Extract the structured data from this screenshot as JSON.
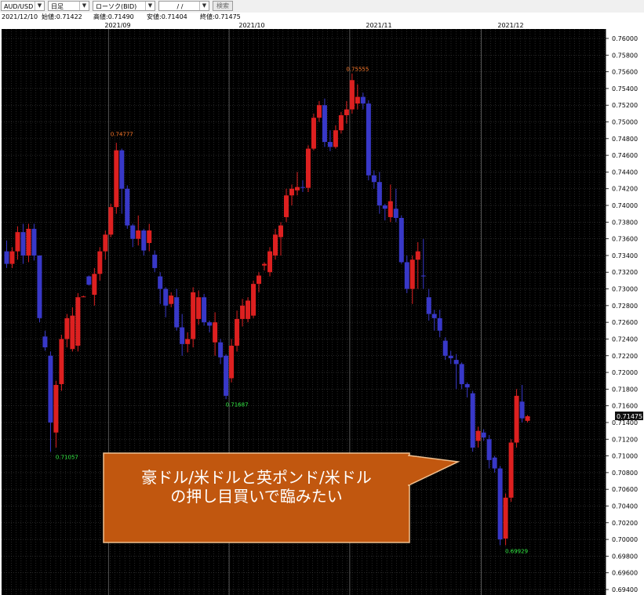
{
  "toolbar": {
    "symbol": "AUD/USD",
    "period": "日足",
    "chart_type": "ローソク(BID)",
    "date": "/ /",
    "search_label": "検索"
  },
  "info": {
    "date": "2021/12/10",
    "open": "始値:0.71422",
    "high": "高値:0.71490",
    "low": "安値:0.71404",
    "close": "終値:0.71475"
  },
  "callout": {
    "line1": "豪ドル/米ドルと英ポンド/米ドル",
    "line2": "の押し目買いで臨みたい"
  },
  "colors": {
    "up": "#dd2020",
    "down": "#3838c8",
    "background": "#000000",
    "grid": "#4a4a4a",
    "callout_fill": "#c1570f"
  },
  "chart_data": {
    "type": "candlestick",
    "x_labels": [
      "2021/09",
      "2021/10",
      "2021/11",
      "2021/12"
    ],
    "y_ticks": [
      "0.76000",
      "0.75800",
      "0.75600",
      "0.75400",
      "0.75200",
      "0.75000",
      "0.74800",
      "0.74600",
      "0.74400",
      "0.74200",
      "0.74000",
      "0.73800",
      "0.73600",
      "0.73400",
      "0.73200",
      "0.73000",
      "0.72800",
      "0.72600",
      "0.72400",
      "0.72200",
      "0.72000",
      "0.71800",
      "0.71600",
      "0.71400",
      "0.71200",
      "0.71000",
      "0.70800",
      "0.70600",
      "0.70400",
      "0.70200",
      "0.70000",
      "0.69800",
      "0.69600",
      "0.69400"
    ],
    "ylim": [
      0.694,
      0.762
    ],
    "current_price": "0.71475",
    "annotations": [
      {
        "text": "0.71057",
        "price": 0.71057,
        "kind": "low"
      },
      {
        "text": "0.74777",
        "price": 0.74777,
        "kind": "high"
      },
      {
        "text": "0.71687",
        "price": 0.71687,
        "kind": "low"
      },
      {
        "text": "0.75555",
        "price": 0.75555,
        "kind": "high"
      },
      {
        "text": "0.69929",
        "price": 0.69929,
        "kind": "low"
      }
    ],
    "candles": [
      [
        0.7345,
        0.7358,
        0.7325,
        0.733
      ],
      [
        0.733,
        0.735,
        0.7325,
        0.7345
      ],
      [
        0.7345,
        0.7375,
        0.7335,
        0.7368
      ],
      [
        0.7368,
        0.7378,
        0.733,
        0.734
      ],
      [
        0.734,
        0.7378,
        0.7332,
        0.7372
      ],
      [
        0.7372,
        0.7378,
        0.7334,
        0.734
      ],
      [
        0.734,
        0.734,
        0.726,
        0.7265
      ],
      [
        0.7243,
        0.725,
        0.7226,
        0.723
      ],
      [
        0.722,
        0.7225,
        0.7105,
        0.714
      ],
      [
        0.7128,
        0.719,
        0.711,
        0.7185
      ],
      [
        0.7186,
        0.7245,
        0.7178,
        0.724
      ],
      [
        0.724,
        0.727,
        0.723,
        0.7265
      ],
      [
        0.7228,
        0.7278,
        0.7225,
        0.7268
      ],
      [
        0.7232,
        0.7295,
        0.7225,
        0.729
      ],
      [
        0.729,
        0.7292,
        0.729,
        0.7291
      ],
      [
        0.7315,
        0.7316,
        0.7304,
        0.7305
      ],
      [
        0.7293,
        0.7325,
        0.728,
        0.7318
      ],
      [
        0.7318,
        0.735,
        0.731,
        0.7345
      ],
      [
        0.7345,
        0.737,
        0.7335,
        0.7365
      ],
      [
        0.7365,
        0.7402,
        0.7362,
        0.7398
      ],
      [
        0.7398,
        0.7475,
        0.739,
        0.7466
      ],
      [
        0.7466,
        0.7468,
        0.739,
        0.742
      ],
      [
        0.742,
        0.7424,
        0.7372,
        0.7376
      ],
      [
        0.7376,
        0.7378,
        0.735,
        0.736
      ],
      [
        0.736,
        0.7388,
        0.7352,
        0.737
      ],
      [
        0.737,
        0.7372,
        0.734,
        0.7346
      ],
      [
        0.7355,
        0.7378,
        0.7345,
        0.737
      ],
      [
        0.7341,
        0.7346,
        0.732,
        0.7325
      ],
      [
        0.7315,
        0.732,
        0.7282,
        0.73
      ],
      [
        0.73,
        0.7302,
        0.7266,
        0.728
      ],
      [
        0.7282,
        0.7296,
        0.7278,
        0.7292
      ],
      [
        0.729,
        0.73,
        0.725,
        0.7254
      ],
      [
        0.7254,
        0.727,
        0.722,
        0.7234
      ],
      [
        0.7234,
        0.7248,
        0.7224,
        0.724
      ],
      [
        0.724,
        0.7302,
        0.723,
        0.7296
      ],
      [
        0.7264,
        0.7298,
        0.7257,
        0.729
      ],
      [
        0.729,
        0.7294,
        0.7256,
        0.726
      ],
      [
        0.726,
        0.7262,
        0.7248,
        0.7256
      ],
      [
        0.7236,
        0.7272,
        0.722,
        0.726
      ],
      [
        0.7236,
        0.724,
        0.721,
        0.7218
      ],
      [
        0.722,
        0.7222,
        0.7168,
        0.7172
      ],
      [
        0.7193,
        0.724,
        0.7188,
        0.7232
      ],
      [
        0.7232,
        0.7274,
        0.7225,
        0.7264
      ],
      [
        0.7264,
        0.7288,
        0.7255,
        0.728
      ],
      [
        0.7264,
        0.729,
        0.726,
        0.7286
      ],
      [
        0.7268,
        0.731,
        0.7265,
        0.7306
      ],
      [
        0.7306,
        0.732,
        0.7296,
        0.7316
      ],
      [
        0.7328,
        0.7332,
        0.7322,
        0.733
      ],
      [
        0.732,
        0.735,
        0.7315,
        0.7345
      ],
      [
        0.734,
        0.7372,
        0.7335,
        0.7365
      ],
      [
        0.7362,
        0.738,
        0.734,
        0.7376
      ],
      [
        0.7386,
        0.742,
        0.738,
        0.7412
      ],
      [
        0.7412,
        0.7425,
        0.74,
        0.742
      ],
      [
        0.7418,
        0.744,
        0.7412,
        0.7422
      ],
      [
        0.7422,
        0.743,
        0.7416,
        0.7421
      ],
      [
        0.7421,
        0.7472,
        0.7416,
        0.7468
      ],
      [
        0.7468,
        0.751,
        0.7466,
        0.7505
      ],
      [
        0.7505,
        0.7525,
        0.75,
        0.752
      ],
      [
        0.752,
        0.7528,
        0.747,
        0.7476
      ],
      [
        0.7476,
        0.749,
        0.7465,
        0.747
      ],
      [
        0.747,
        0.7496,
        0.7468,
        0.749
      ],
      [
        0.749,
        0.7512,
        0.7486,
        0.7508
      ],
      [
        0.7508,
        0.7525,
        0.7498,
        0.7515
      ],
      [
        0.7515,
        0.7558,
        0.751,
        0.755
      ],
      [
        0.7522,
        0.7545,
        0.7515,
        0.753
      ],
      [
        0.753,
        0.7535,
        0.7515,
        0.7522
      ],
      [
        0.7522,
        0.7526,
        0.743,
        0.7436
      ],
      [
        0.7436,
        0.7442,
        0.742,
        0.7428
      ],
      [
        0.7428,
        0.744,
        0.739,
        0.74
      ],
      [
        0.74,
        0.7402,
        0.7382,
        0.7396
      ],
      [
        0.7386,
        0.7425,
        0.738,
        0.7405
      ],
      [
        0.7396,
        0.742,
        0.738,
        0.7385
      ],
      [
        0.7385,
        0.7388,
        0.733,
        0.7332
      ],
      [
        0.7332,
        0.734,
        0.7295,
        0.73
      ],
      [
        0.73,
        0.734,
        0.7282,
        0.7335
      ],
      [
        0.7335,
        0.7356,
        0.73,
        0.7345
      ],
      [
        0.7316,
        0.736,
        0.73,
        0.7315
      ],
      [
        0.729,
        0.73,
        0.7262,
        0.727
      ],
      [
        0.727,
        0.7275,
        0.725,
        0.7265
      ],
      [
        0.7265,
        0.7275,
        0.7242,
        0.725
      ],
      [
        0.7238,
        0.7242,
        0.7215,
        0.722
      ],
      [
        0.722,
        0.7226,
        0.721,
        0.7217
      ],
      [
        0.7215,
        0.7222,
        0.718,
        0.721
      ],
      [
        0.721,
        0.7212,
        0.718,
        0.7186
      ],
      [
        0.7186,
        0.7188,
        0.717,
        0.7182
      ],
      [
        0.7175,
        0.7178,
        0.7105,
        0.711
      ],
      [
        0.7118,
        0.7135,
        0.711,
        0.713
      ],
      [
        0.7128,
        0.7132,
        0.7118,
        0.7122
      ],
      [
        0.712,
        0.7125,
        0.7085,
        0.7095
      ],
      [
        0.7098,
        0.71,
        0.708,
        0.7085
      ],
      [
        0.7085,
        0.7088,
        0.6993,
        0.7
      ],
      [
        0.7001,
        0.7055,
        0.6993,
        0.705
      ],
      [
        0.705,
        0.712,
        0.7045,
        0.7116
      ],
      [
        0.7116,
        0.718,
        0.711,
        0.7172
      ],
      [
        0.7165,
        0.7185,
        0.714,
        0.7145
      ],
      [
        0.7142,
        0.7149,
        0.714,
        0.71475
      ]
    ]
  }
}
